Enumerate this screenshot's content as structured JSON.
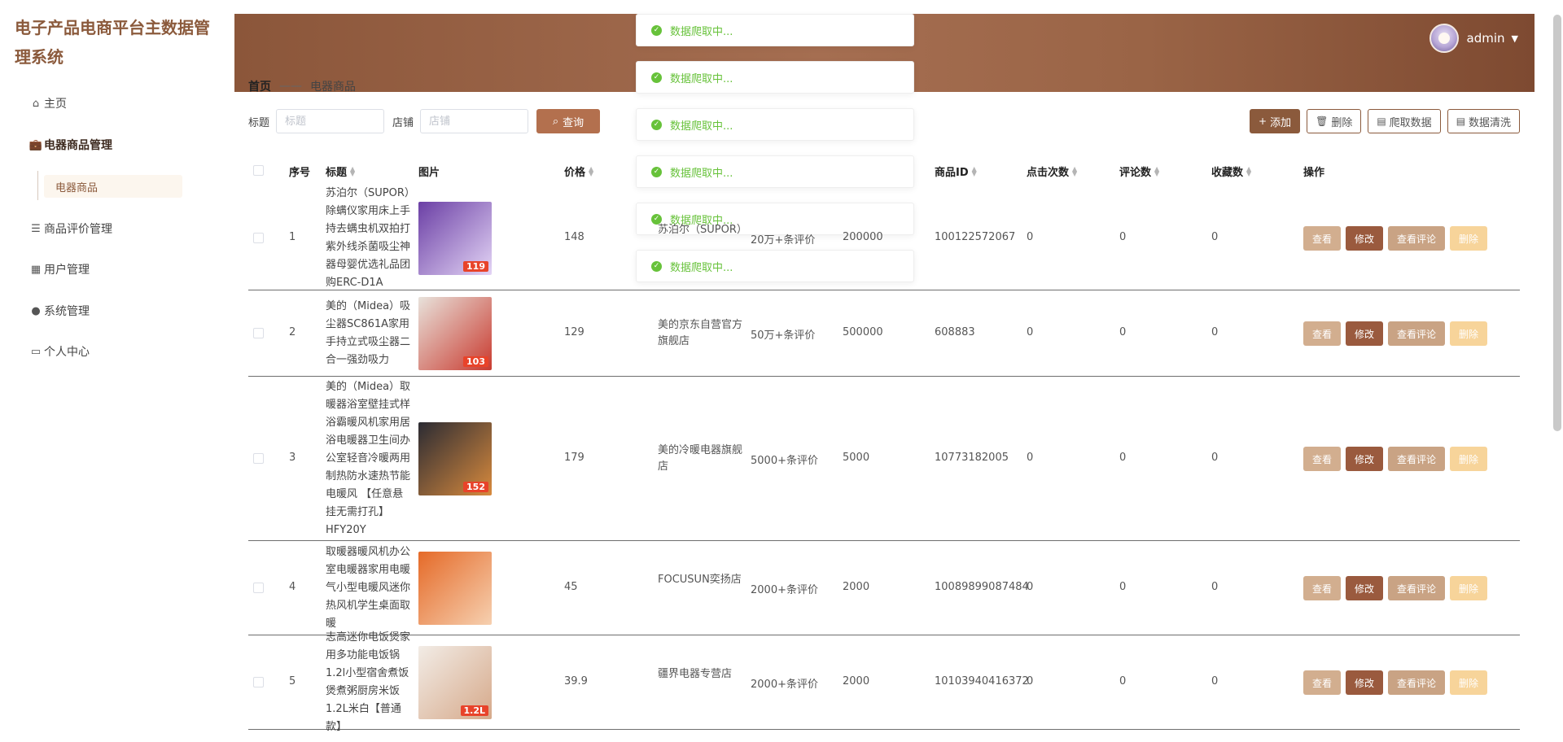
{
  "brand": "电子产品电商平台主数据管理系统",
  "menu": {
    "home": "主页",
    "goods_mgmt": "电器商品管理",
    "goods": "电器商品",
    "review_mgmt": "商品评价管理",
    "user_mgmt": "用户管理",
    "sys_mgmt": "系统管理",
    "profile": "个人中心"
  },
  "header": {
    "user": "admin"
  },
  "toasts": [
    "数据爬取中...",
    "数据爬取中...",
    "数据爬取中...",
    "数据爬取中...",
    "数据爬取中...",
    "数据爬取中..."
  ],
  "breadcrumb": {
    "home": "首页",
    "sep": "——",
    "current": "电器商品"
  },
  "search": {
    "title_label": "标题",
    "title_placeholder": "标题",
    "shop_label": "店铺",
    "shop_placeholder": "店铺",
    "query": "查询"
  },
  "actions": {
    "add": "添加",
    "delete": "删除",
    "crawl": "爬取数据",
    "clean": "数据清洗"
  },
  "columns": {
    "no": "序号",
    "title": "标题",
    "image": "图片",
    "price": "价格",
    "goods_id": "商品ID",
    "clicks": "点击次数",
    "reviews": "评论数",
    "favorites": "收藏数",
    "op": "操作"
  },
  "ops": {
    "view": "查看",
    "edit": "修改",
    "comments": "查看评论",
    "delete": "删除"
  },
  "rows": [
    {
      "no": "1",
      "title": "苏泊尔（SUPOR）除螨仪家用床上手持去螨虫机双拍打紫外线杀菌吸尘神器母婴优选礼品团购ERC-D1A",
      "price": "148",
      "shop": "苏泊尔（SUPOR）",
      "comment_count": "20万+条评价",
      "count": "200000",
      "goods_id": "100122572067",
      "clicks": "0",
      "reviews": "0",
      "favorites": "0",
      "badge": "119"
    },
    {
      "no": "2",
      "title": "美的（Midea）吸尘器SC861A家用手持立式吸尘器二合一强劲吸力",
      "price": "129",
      "shop": "美的京东自营官方旗舰店",
      "comment_count": "50万+条评价",
      "count": "500000",
      "goods_id": "608883",
      "clicks": "0",
      "reviews": "0",
      "favorites": "0",
      "badge": "103"
    },
    {
      "no": "3",
      "title": "美的（Midea）取暖器浴室壁挂式样浴霸暖风机家用居浴电暖器卫生间办公室轻音冷暖两用制热防水速热节能电暖风 【任意悬挂无需打孔】HFY20Y",
      "price": "179",
      "shop": "美的冷暖电器旗舰店",
      "comment_count": "5000+条评价",
      "count": "5000",
      "goods_id": "10773182005",
      "clicks": "0",
      "reviews": "0",
      "favorites": "0",
      "badge": "152"
    },
    {
      "no": "4",
      "title": "取暖器暖风机办公室电暖器家用电暖气小型电暖风迷你热风机学生桌面取暖",
      "price": "45",
      "shop": "FOCUSUN奕扬店",
      "comment_count": "2000+条评价",
      "count": "2000",
      "goods_id": "10089899087484",
      "clicks": "0",
      "reviews": "0",
      "favorites": "0",
      "badge": ""
    },
    {
      "no": "5",
      "title": "志高迷你电饭煲家用多功能电饭锅1.2l小型宿舍煮饭煲煮粥厨房米饭 1.2L米白【普通款】",
      "price": "39.9",
      "shop": "疆界电器专营店",
      "comment_count": "2000+条评价",
      "count": "2000",
      "goods_id": "10103940416372",
      "clicks": "0",
      "reviews": "0",
      "favorites": "0",
      "badge": "1.2L"
    }
  ]
}
